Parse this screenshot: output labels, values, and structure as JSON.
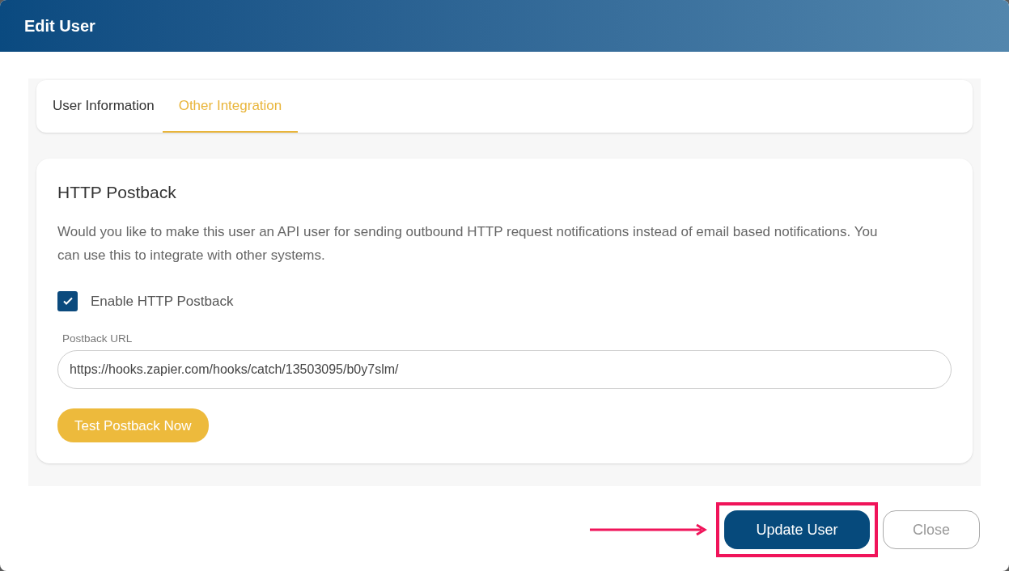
{
  "window": {
    "title": "Edit User"
  },
  "tabs": [
    {
      "label": "User Information",
      "selected": false
    },
    {
      "label": "Other Integration",
      "selected": true
    }
  ],
  "section": {
    "title": "HTTP Postback",
    "description": "Would you like to make this user an API user for sending outbound HTTP request notifications instead of email based notifications. You can use this to integrate with other systems.",
    "checkbox": {
      "label": "Enable HTTP Postback",
      "checked": true
    },
    "field": {
      "label": "Postback URL",
      "value": "https://hooks.zapier.com/hooks/catch/13503095/b0y7slm/"
    },
    "test_button": "Test Postback Now"
  },
  "buttons": [
    {
      "label": "Update User",
      "kind": "primary",
      "highlighted": true
    },
    {
      "label": "Close",
      "kind": "secondary",
      "highlighted": false
    }
  ]
}
